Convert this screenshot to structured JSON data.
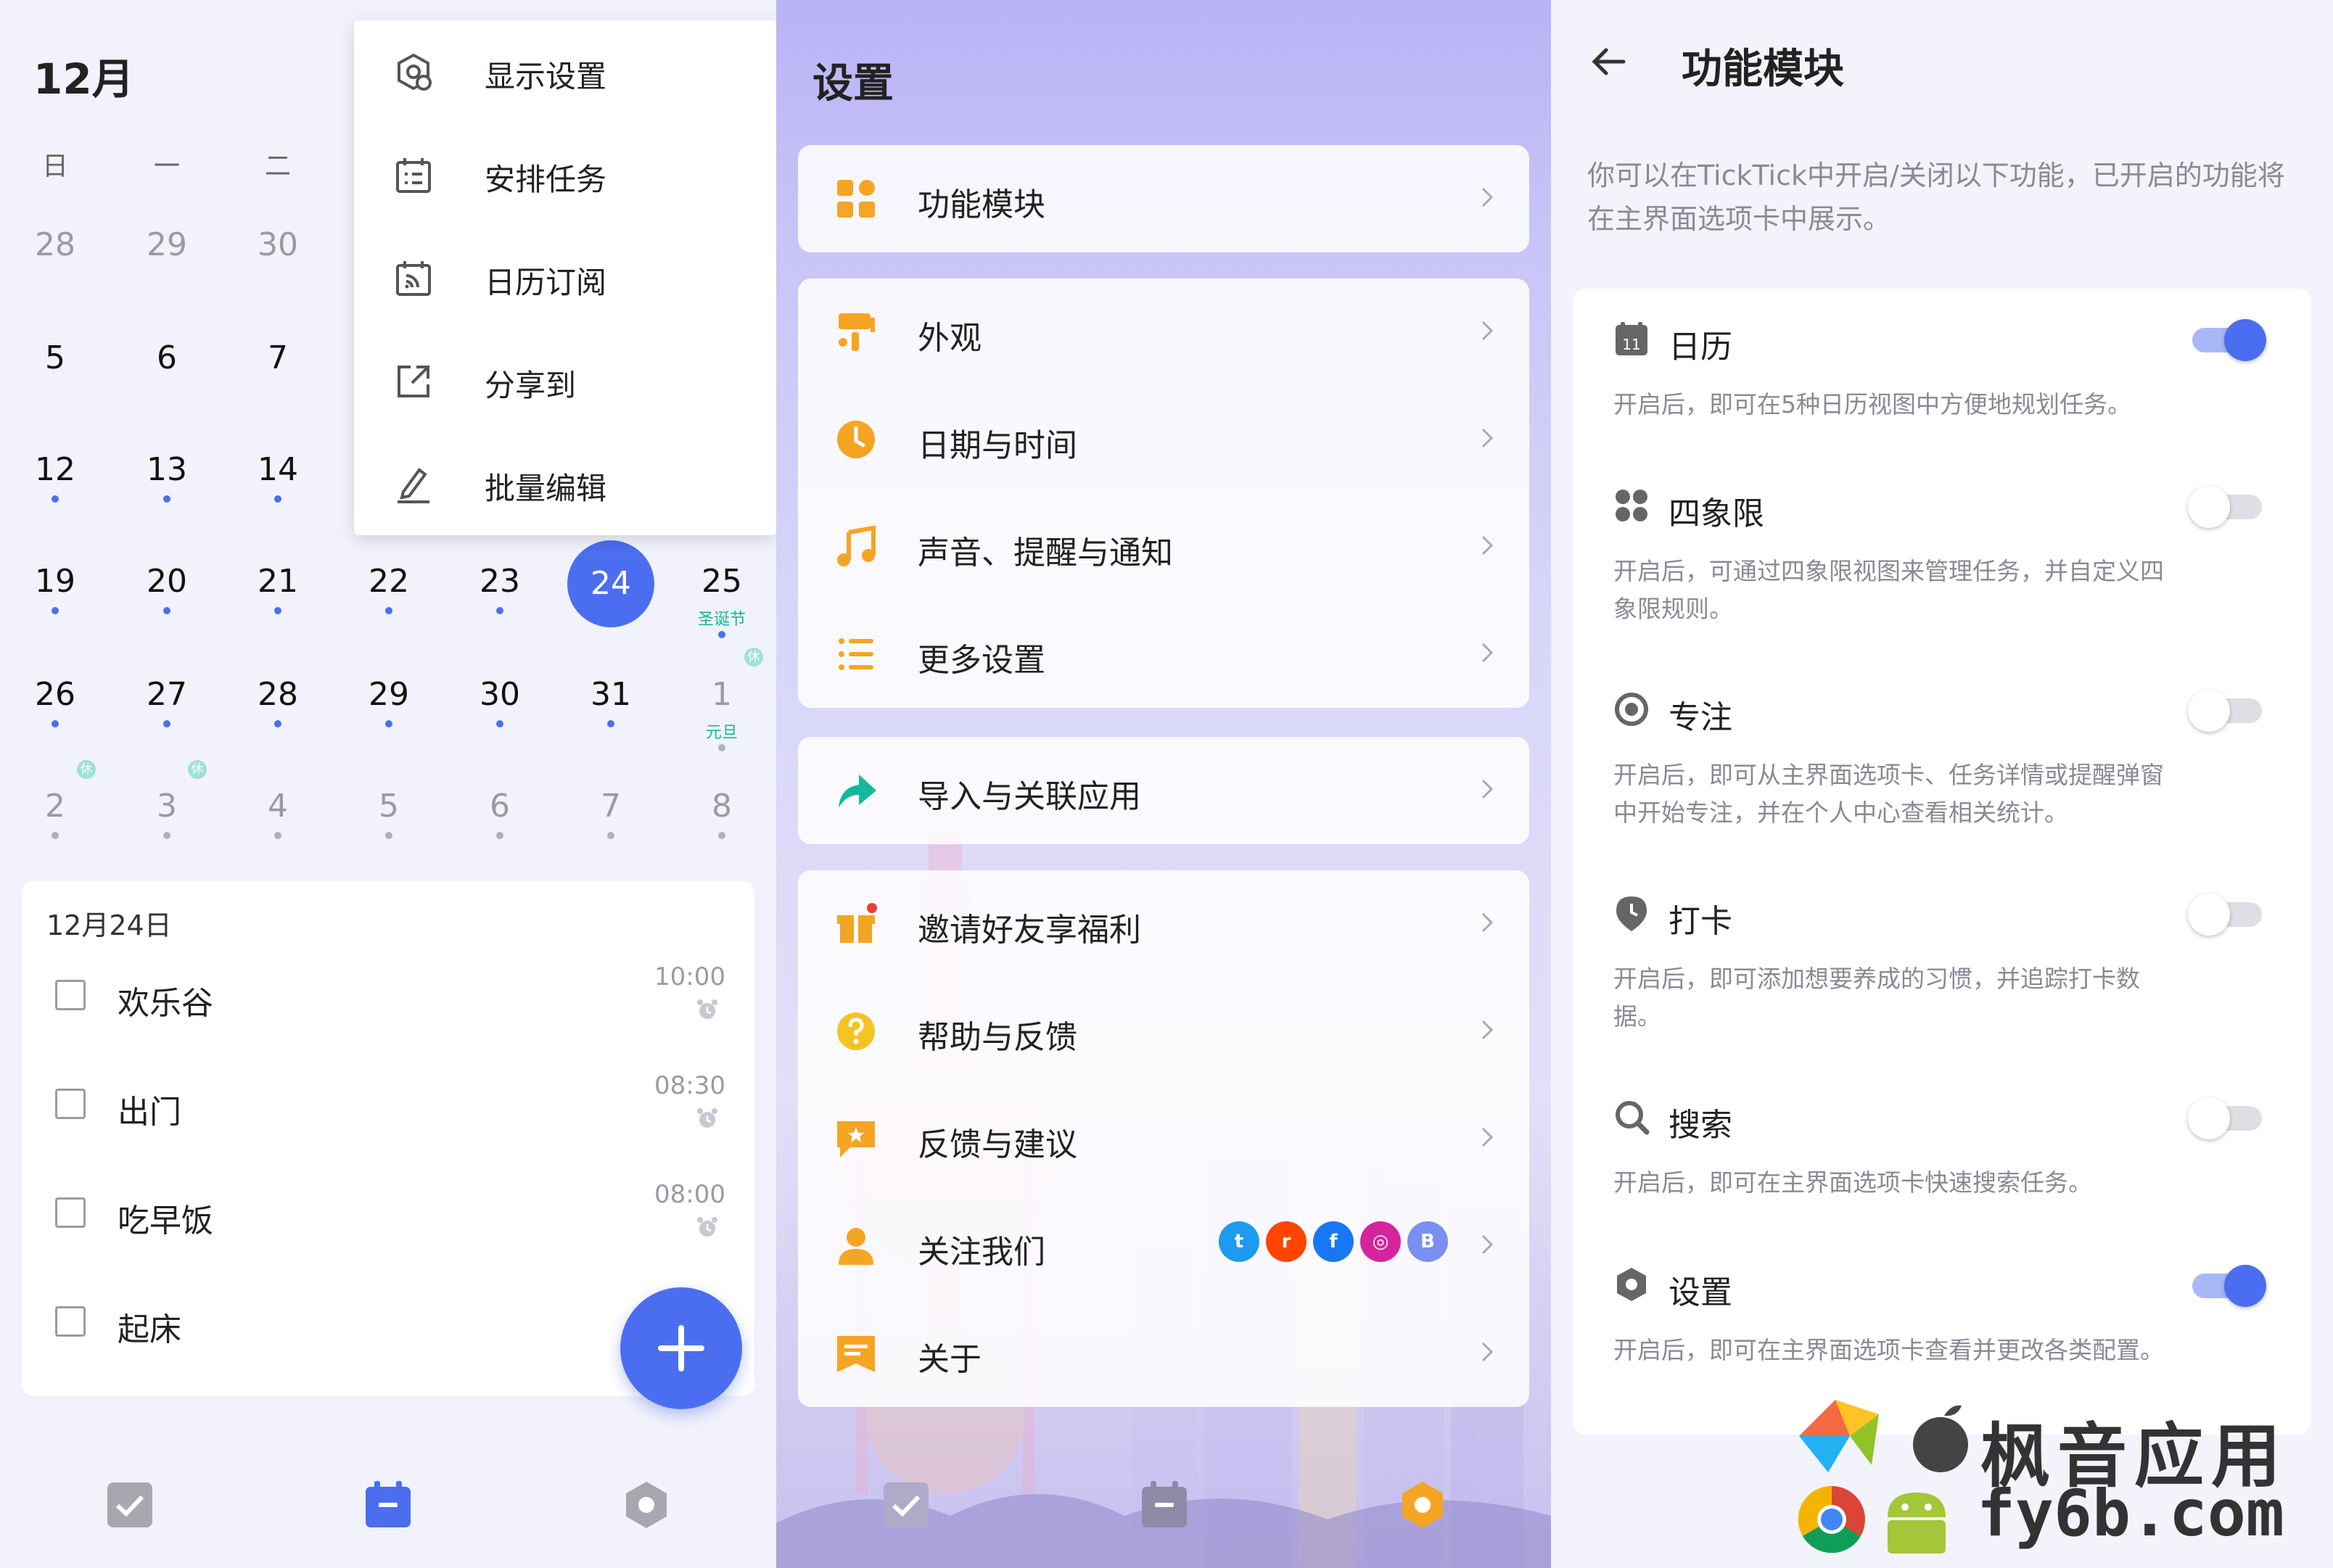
{
  "calendar": {
    "month": "12月",
    "weekdays": [
      "日",
      "一",
      "二"
    ],
    "weeks": [
      {
        "days": [
          "28",
          "29",
          "30"
        ]
      },
      {
        "days": [
          "5",
          "6",
          "7"
        ]
      },
      {
        "days": [
          "12",
          "13",
          "14"
        ]
      },
      {
        "days": [
          "19",
          "20",
          "21",
          "22",
          "23",
          "24",
          "25"
        ]
      },
      {
        "days": [
          "26",
          "27",
          "28",
          "29",
          "30",
          "31",
          "1"
        ]
      },
      {
        "days": [
          "2",
          "3",
          "4",
          "5",
          "6",
          "7",
          "8"
        ]
      }
    ],
    "holidays": {
      "christmas": "圣诞节",
      "newyear": "元旦"
    },
    "rest_label": "休",
    "selected_day": "24",
    "menu": [
      {
        "label": "显示设置",
        "icon": "display-settings-icon"
      },
      {
        "label": "安排任务",
        "icon": "schedule-task-icon"
      },
      {
        "label": "日历订阅",
        "icon": "calendar-subscribe-icon"
      },
      {
        "label": "分享到",
        "icon": "share-icon"
      },
      {
        "label": "批量编辑",
        "icon": "batch-edit-icon"
      }
    ],
    "task_date": "12月24日",
    "tasks": [
      {
        "name": "欢乐谷",
        "time": "10:00"
      },
      {
        "name": "出门",
        "time": "08:30"
      },
      {
        "name": "吃早饭",
        "time": "08:00"
      },
      {
        "name": "起床",
        "time": ""
      }
    ]
  },
  "settings": {
    "title": "设置",
    "groups": [
      [
        {
          "label": "功能模块",
          "icon": "modules-icon"
        }
      ],
      [
        {
          "label": "外观",
          "icon": "appearance-icon"
        },
        {
          "label": "日期与时间",
          "icon": "clock-icon"
        },
        {
          "label": "声音、提醒与通知",
          "icon": "music-icon"
        },
        {
          "label": "更多设置",
          "icon": "more-settings-icon"
        }
      ],
      [
        {
          "label": "导入与关联应用",
          "icon": "import-icon"
        }
      ],
      [
        {
          "label": "邀请好友享福利",
          "icon": "gift-icon"
        },
        {
          "label": "帮助与反馈",
          "icon": "help-icon"
        },
        {
          "label": "反馈与建议",
          "icon": "feedback-icon"
        },
        {
          "label": "关注我们",
          "icon": "follow-icon"
        },
        {
          "label": "关于",
          "icon": "about-icon"
        }
      ]
    ],
    "social": [
      "twitter-icon",
      "reddit-icon",
      "facebook-icon",
      "instagram-icon",
      "weibo-icon"
    ]
  },
  "modules": {
    "title": "功能模块",
    "description": "你可以在TickTick中开启/关闭以下功能，已开启的功能将在主界面选项卡中展示。",
    "features": [
      {
        "name": "日历",
        "desc": "开启后，即可在5种日历视图中方便地规划任务。",
        "on": true,
        "icon": "calendar-icon",
        "badge": "11"
      },
      {
        "name": "四象限",
        "desc": "开启后，可通过四象限视图来管理任务，并自定义四象限规则。",
        "on": false,
        "icon": "quadrant-icon"
      },
      {
        "name": "专注",
        "desc": "开启后，即可从主界面选项卡、任务详情或提醒弹窗中开始专注，并在个人中心查看相关统计。",
        "on": false,
        "icon": "focus-icon"
      },
      {
        "name": "打卡",
        "desc": "开启后，即可添加想要养成的习惯，并追踪打卡数据。",
        "on": false,
        "icon": "habit-icon"
      },
      {
        "name": "搜索",
        "desc": "开启后，即可在主界面选项卡快速搜索任务。",
        "on": false,
        "icon": "search-icon"
      },
      {
        "name": "设置",
        "desc": "开启后，即可在主界面选项卡查看并更改各类配置。",
        "on": true,
        "icon": "settings-icon"
      }
    ]
  },
  "watermark": {
    "brand": "枫音应用",
    "url": "fy6b.com"
  },
  "colors": {
    "accent": "#4b6ef0",
    "orange": "#f5a524",
    "green": "#16b89a"
  }
}
